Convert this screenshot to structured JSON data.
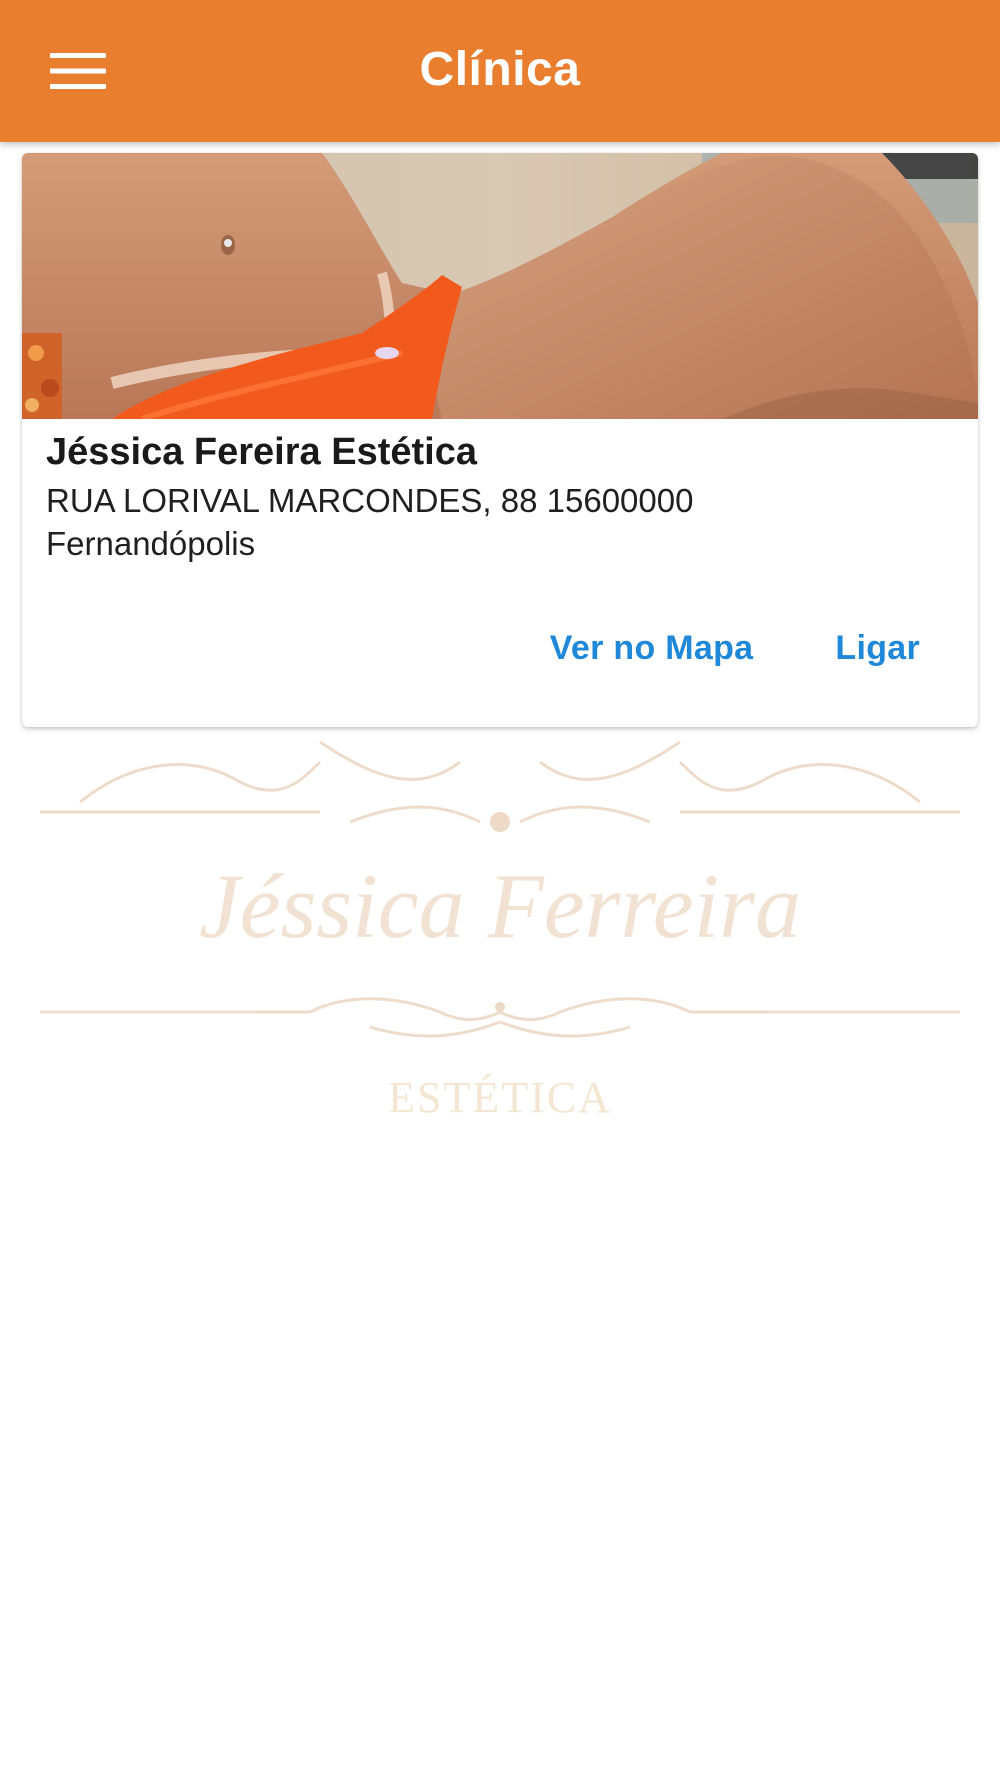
{
  "app_bar": {
    "title": "Clínica",
    "menu_icon": "hamburger-menu-icon",
    "color": "#ea7e2f"
  },
  "card": {
    "image_description_icon": "clinic-photo",
    "title": "Jéssica Fereira Estética",
    "address_line": "RUA LORIVAL MARCONDES, 88 15600000",
    "city": "Fernandópolis",
    "actions": {
      "map_label": "Ver no Mapa",
      "call_label": "Ligar"
    },
    "action_color": "#1f88d9"
  },
  "watermark": {
    "name": "Jéssica Ferreira",
    "subtitle": "ESTÉTICA"
  }
}
